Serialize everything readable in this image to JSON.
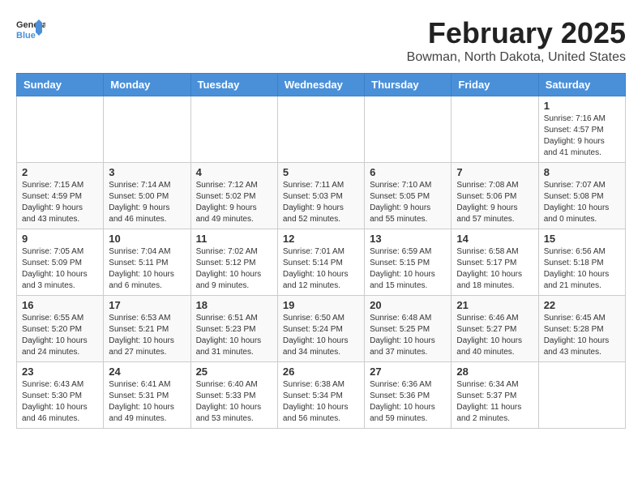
{
  "header": {
    "logo_general": "General",
    "logo_blue": "Blue",
    "month_year": "February 2025",
    "location": "Bowman, North Dakota, United States"
  },
  "weekdays": [
    "Sunday",
    "Monday",
    "Tuesday",
    "Wednesday",
    "Thursday",
    "Friday",
    "Saturday"
  ],
  "weeks": [
    [
      {
        "day": "",
        "info": ""
      },
      {
        "day": "",
        "info": ""
      },
      {
        "day": "",
        "info": ""
      },
      {
        "day": "",
        "info": ""
      },
      {
        "day": "",
        "info": ""
      },
      {
        "day": "",
        "info": ""
      },
      {
        "day": "1",
        "info": "Sunrise: 7:16 AM\nSunset: 4:57 PM\nDaylight: 9 hours and 41 minutes."
      }
    ],
    [
      {
        "day": "2",
        "info": "Sunrise: 7:15 AM\nSunset: 4:59 PM\nDaylight: 9 hours and 43 minutes."
      },
      {
        "day": "3",
        "info": "Sunrise: 7:14 AM\nSunset: 5:00 PM\nDaylight: 9 hours and 46 minutes."
      },
      {
        "day": "4",
        "info": "Sunrise: 7:12 AM\nSunset: 5:02 PM\nDaylight: 9 hours and 49 minutes."
      },
      {
        "day": "5",
        "info": "Sunrise: 7:11 AM\nSunset: 5:03 PM\nDaylight: 9 hours and 52 minutes."
      },
      {
        "day": "6",
        "info": "Sunrise: 7:10 AM\nSunset: 5:05 PM\nDaylight: 9 hours and 55 minutes."
      },
      {
        "day": "7",
        "info": "Sunrise: 7:08 AM\nSunset: 5:06 PM\nDaylight: 9 hours and 57 minutes."
      },
      {
        "day": "8",
        "info": "Sunrise: 7:07 AM\nSunset: 5:08 PM\nDaylight: 10 hours and 0 minutes."
      }
    ],
    [
      {
        "day": "9",
        "info": "Sunrise: 7:05 AM\nSunset: 5:09 PM\nDaylight: 10 hours and 3 minutes."
      },
      {
        "day": "10",
        "info": "Sunrise: 7:04 AM\nSunset: 5:11 PM\nDaylight: 10 hours and 6 minutes."
      },
      {
        "day": "11",
        "info": "Sunrise: 7:02 AM\nSunset: 5:12 PM\nDaylight: 10 hours and 9 minutes."
      },
      {
        "day": "12",
        "info": "Sunrise: 7:01 AM\nSunset: 5:14 PM\nDaylight: 10 hours and 12 minutes."
      },
      {
        "day": "13",
        "info": "Sunrise: 6:59 AM\nSunset: 5:15 PM\nDaylight: 10 hours and 15 minutes."
      },
      {
        "day": "14",
        "info": "Sunrise: 6:58 AM\nSunset: 5:17 PM\nDaylight: 10 hours and 18 minutes."
      },
      {
        "day": "15",
        "info": "Sunrise: 6:56 AM\nSunset: 5:18 PM\nDaylight: 10 hours and 21 minutes."
      }
    ],
    [
      {
        "day": "16",
        "info": "Sunrise: 6:55 AM\nSunset: 5:20 PM\nDaylight: 10 hours and 24 minutes."
      },
      {
        "day": "17",
        "info": "Sunrise: 6:53 AM\nSunset: 5:21 PM\nDaylight: 10 hours and 27 minutes."
      },
      {
        "day": "18",
        "info": "Sunrise: 6:51 AM\nSunset: 5:23 PM\nDaylight: 10 hours and 31 minutes."
      },
      {
        "day": "19",
        "info": "Sunrise: 6:50 AM\nSunset: 5:24 PM\nDaylight: 10 hours and 34 minutes."
      },
      {
        "day": "20",
        "info": "Sunrise: 6:48 AM\nSunset: 5:25 PM\nDaylight: 10 hours and 37 minutes."
      },
      {
        "day": "21",
        "info": "Sunrise: 6:46 AM\nSunset: 5:27 PM\nDaylight: 10 hours and 40 minutes."
      },
      {
        "day": "22",
        "info": "Sunrise: 6:45 AM\nSunset: 5:28 PM\nDaylight: 10 hours and 43 minutes."
      }
    ],
    [
      {
        "day": "23",
        "info": "Sunrise: 6:43 AM\nSunset: 5:30 PM\nDaylight: 10 hours and 46 minutes."
      },
      {
        "day": "24",
        "info": "Sunrise: 6:41 AM\nSunset: 5:31 PM\nDaylight: 10 hours and 49 minutes."
      },
      {
        "day": "25",
        "info": "Sunrise: 6:40 AM\nSunset: 5:33 PM\nDaylight: 10 hours and 53 minutes."
      },
      {
        "day": "26",
        "info": "Sunrise: 6:38 AM\nSunset: 5:34 PM\nDaylight: 10 hours and 56 minutes."
      },
      {
        "day": "27",
        "info": "Sunrise: 6:36 AM\nSunset: 5:36 PM\nDaylight: 10 hours and 59 minutes."
      },
      {
        "day": "28",
        "info": "Sunrise: 6:34 AM\nSunset: 5:37 PM\nDaylight: 11 hours and 2 minutes."
      },
      {
        "day": "",
        "info": ""
      }
    ]
  ]
}
